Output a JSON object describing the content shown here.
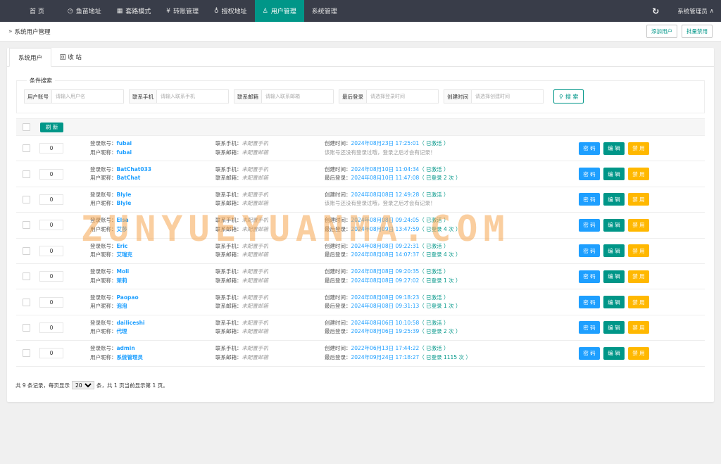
{
  "nav": {
    "items": [
      {
        "label": "首 页",
        "icon": ""
      },
      {
        "label": "鱼苗地址",
        "icon": "◷"
      },
      {
        "label": "套路模式",
        "icon": "▦"
      },
      {
        "label": "转账管理",
        "icon": "¥"
      },
      {
        "label": "授权地址",
        "icon": "♁"
      },
      {
        "label": "用户管理",
        "icon": "♙"
      },
      {
        "label": "系统管理",
        "icon": ""
      }
    ],
    "refresh_icon": "↻",
    "user_label": "系统管理员",
    "user_caret": "∧"
  },
  "crumb": {
    "icon": "»",
    "text": "系统用户管理",
    "add_btn": "添加用户",
    "batch_btn": "批量禁用"
  },
  "tabs": [
    "系统用户",
    "回 收 站"
  ],
  "search": {
    "legend": "条件搜索",
    "fields": [
      {
        "label": "用户账号",
        "placeholder": "请输入用户名"
      },
      {
        "label": "联系手机",
        "placeholder": "请输入联系手机"
      },
      {
        "label": "联系邮箱",
        "placeholder": "请输入联系邮箱"
      },
      {
        "label": "最后登录",
        "placeholder": "请选择登录时间"
      },
      {
        "label": "创建时间",
        "placeholder": "请选择创建时间"
      }
    ],
    "button": "搜 索",
    "button_icon": "⚲"
  },
  "table": {
    "refresh": "刷 新",
    "labels": {
      "account": "登录账号：",
      "nickname": "用户昵称：",
      "phone": "联系手机：",
      "email": "联系邮箱：",
      "created": "创建时间：",
      "last_login": "最后登录：",
      "phone_unset": "未配置手机",
      "email_unset": "未配置邮箱",
      "no_login": "该账号还没有登录过哦，登录之后才会有记录！",
      "btn_pwd": "密 码",
      "btn_edit": "编 辑",
      "btn_ban": "禁 用"
    },
    "rows": [
      {
        "sort": "0",
        "account": "fubai",
        "nickname": "fubai",
        "created": "2024年08月23日 17:25:01",
        "status": "（ 已激活 ）",
        "last": "",
        "last_count": ""
      },
      {
        "sort": "0",
        "account": "BatChat033",
        "nickname": "BatChat",
        "created": "2024年08月10日 11:04:34",
        "status": "（ 已激活 ）",
        "last": "2024年08月10日 11:47:08",
        "last_count": "（ 已登录 2 次 ）"
      },
      {
        "sort": "0",
        "account": "Blyle",
        "nickname": "Blyle",
        "created": "2024年08月08日 12:49:28",
        "status": "（ 已激活 ）",
        "last": "",
        "last_count": ""
      },
      {
        "sort": "0",
        "account": "Elsa",
        "nickname": "艾莎",
        "created": "2024年08月08日 09:24:05",
        "status": "（ 已激活 ）",
        "last": "2024年08月09日 13:47:59",
        "last_count": "（ 已登录 4 次 ）"
      },
      {
        "sort": "0",
        "account": "Eric",
        "nickname": "艾瑞克",
        "created": "2024年08月08日 09:22:31",
        "status": "（ 已激活 ）",
        "last": "2024年08月08日 14:07:37",
        "last_count": "（ 已登录 4 次 ）"
      },
      {
        "sort": "0",
        "account": "Moli",
        "nickname": "茉莉",
        "created": "2024年08月08日 09:20:35",
        "status": "（ 已激活 ）",
        "last": "2024年08月08日 09:27:02",
        "last_count": "（ 已登录 1 次 ）"
      },
      {
        "sort": "0",
        "account": "Paopao",
        "nickname": "泡泡",
        "created": "2024年08月08日 09:18:23",
        "status": "（ 已激活 ）",
        "last": "2024年08月08日 09:31:13",
        "last_count": "（ 已登录 1 次 ）"
      },
      {
        "sort": "0",
        "account": "dailiceshi",
        "nickname": "代理",
        "created": "2024年08月06日 10:10:58",
        "status": "（ 已激活 ）",
        "last": "2024年08月06日 19:25:39",
        "last_count": "（ 已登录 2 次 ）"
      },
      {
        "sort": "0",
        "account": "admin",
        "nickname": "系统管理员",
        "created": "2022年06月13日 17:44:22",
        "status": "（ 已激活 ）",
        "last": "2024年09月24日 17:18:27",
        "last_count": "（ 已登录 1115 次 ）"
      }
    ]
  },
  "pager": {
    "prefix": "共 9 条记录，每页显示",
    "page_size": "20",
    "suffix": "条，共 1 页当前显示第 1 页。"
  },
  "watermark": "ZUNYUEYUANMA.COM",
  "colors": {
    "nav_bg": "#393d49",
    "accent": "#009688",
    "blue": "#1e9fff",
    "yellow": "#ffb800"
  }
}
